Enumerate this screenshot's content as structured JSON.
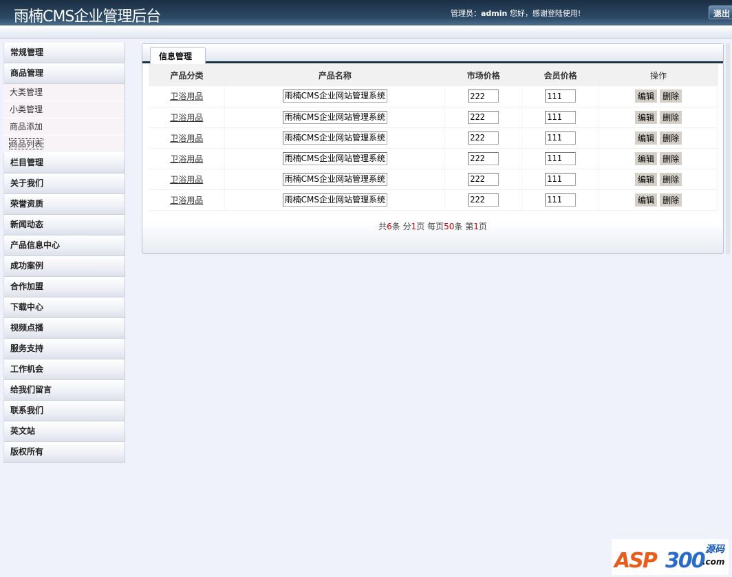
{
  "header": {
    "title": "雨楠CMS企业管理后台",
    "welcome_prefix": "管理员：",
    "user": "admin",
    "welcome_suffix": " 您好，感谢登陆使用!",
    "logout": "退出"
  },
  "sidebar": {
    "items": [
      {
        "label": "常规管理"
      },
      {
        "label": "商品管理",
        "sub": [
          "大类管理",
          "小类管理",
          "商品添加",
          "商品列表"
        ]
      },
      {
        "label": "栏目管理"
      },
      {
        "label": "关于我们"
      },
      {
        "label": "荣誉资质"
      },
      {
        "label": "新闻动态"
      },
      {
        "label": "产品信息中心"
      },
      {
        "label": "成功案例"
      },
      {
        "label": "合作加盟"
      },
      {
        "label": "下载中心"
      },
      {
        "label": "视频点播"
      },
      {
        "label": "服务支持"
      },
      {
        "label": "工作机会"
      },
      {
        "label": "给我们留言"
      },
      {
        "label": "联系我们"
      },
      {
        "label": "英文站"
      },
      {
        "label": "版权所有"
      }
    ]
  },
  "panel": {
    "tab": "信息管理",
    "columns": [
      "产品分类",
      "产品名称",
      "市场价格",
      "会员价格",
      "操作"
    ],
    "rows": [
      {
        "category": "卫浴用品",
        "name": "雨楠CMS企业网站管理系统",
        "market": "222",
        "member": "111"
      },
      {
        "category": "卫浴用品",
        "name": "雨楠CMS企业网站管理系统",
        "market": "222",
        "member": "111"
      },
      {
        "category": "卫浴用品",
        "name": "雨楠CMS企业网站管理系统",
        "market": "222",
        "member": "111"
      },
      {
        "category": "卫浴用品",
        "name": "雨楠CMS企业网站管理系统",
        "market": "222",
        "member": "111"
      },
      {
        "category": "卫浴用品",
        "name": "雨楠CMS企业网站管理系统",
        "market": "222",
        "member": "111"
      },
      {
        "category": "卫浴用品",
        "name": "雨楠CMS企业网站管理系统",
        "market": "222",
        "member": "111"
      }
    ],
    "edit": "编辑",
    "delete": "删除",
    "pager": {
      "t1": "共",
      "total": "6",
      "t2": "条  分",
      "pages": "1",
      "t3": "页  每页",
      "per": "50",
      "t4": "条  第",
      "cur": "1",
      "t5": "页"
    }
  },
  "watermark": {
    "text": "ASP300",
    "cn": "源码",
    "com": ".com"
  }
}
